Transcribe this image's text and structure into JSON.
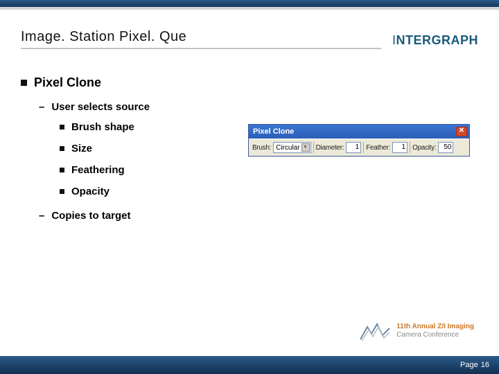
{
  "slide": {
    "title": "Image. Station Pixel. Que",
    "brand": "INTERGRAPH"
  },
  "bullets": {
    "main": "Pixel Clone",
    "sub1": "User selects source",
    "items": [
      "Brush shape",
      "Size",
      "Feathering",
      "Opacity"
    ],
    "sub2": "Copies to target"
  },
  "toolbar": {
    "title": "Pixel Clone",
    "close": "✕",
    "brush_label": "Brush:",
    "brush_value": "Circular",
    "diameter_label": "Diameter:",
    "diameter_value": "1",
    "feather_label": "Feather:",
    "feather_value": "1",
    "opacity_label": "Opacity:",
    "opacity_value": "50"
  },
  "conference": {
    "line1": "11th Annual Z/I Imaging",
    "line2": "Camera Conference"
  },
  "footer": {
    "page_label": "Page",
    "page_number": "16"
  }
}
